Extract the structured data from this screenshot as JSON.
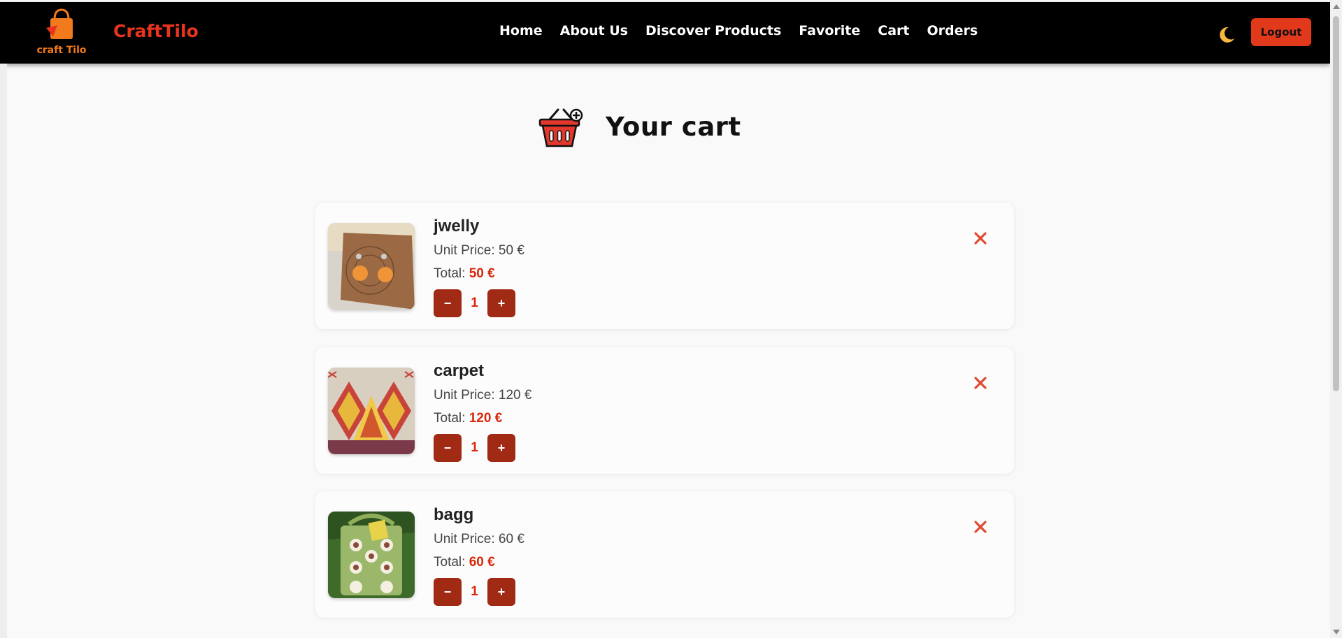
{
  "brand": {
    "logo_text": "craft Tilo",
    "name": "CraftTilo",
    "accent": "#e8341c"
  },
  "nav": {
    "items": [
      {
        "label": "Home"
      },
      {
        "label": "About Us"
      },
      {
        "label": "Discover Products"
      },
      {
        "label": "Favorite"
      },
      {
        "label": "Cart"
      },
      {
        "label": "Orders"
      }
    ]
  },
  "header_actions": {
    "theme_icon": "moon-icon",
    "logout_label": "Logout"
  },
  "page": {
    "title": "Your cart",
    "title_icon": "shopping-basket-icon"
  },
  "cart": {
    "items": [
      {
        "name": "jwelly",
        "unit_label": "Unit Price: 50 €",
        "total_label": "Total:",
        "total_value": "50 €",
        "quantity": "1",
        "image": "earrings-photo"
      },
      {
        "name": "carpet",
        "unit_label": "Unit Price: 120 €",
        "total_label": "Total:",
        "total_value": "120 €",
        "quantity": "1",
        "image": "carpet-photo"
      },
      {
        "name": "bagg",
        "unit_label": "Unit Price: 60 €",
        "total_label": "Total:",
        "total_value": "60 €",
        "quantity": "1",
        "image": "bag-photo"
      }
    ],
    "minus_label": "−",
    "plus_label": "+"
  },
  "colors": {
    "button": "#a02a14",
    "price": "#d9280c",
    "remove": "#e04a32",
    "logout": "#e2381c"
  }
}
